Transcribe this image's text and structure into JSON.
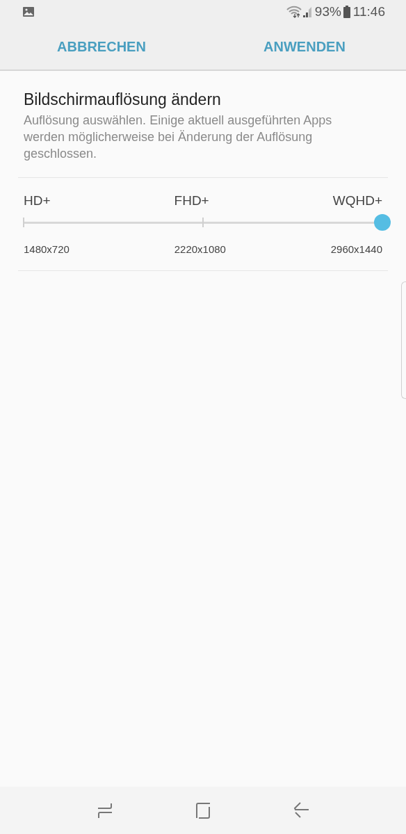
{
  "status_bar": {
    "battery": "93%",
    "time": "11:46"
  },
  "toolbar": {
    "buttons": [
      "ABBRECHEN",
      "ANWENDEN"
    ]
  },
  "title": "Bildschirmauflösung ändern",
  "description": "Auflösung auswählen. Einige aktuell ausgeführten Apps werden möglicherweise bei Änderung der Auflösung geschlossen.",
  "slider": {
    "level": 1,
    "stops": [
      {
        "label": "HD+",
        "resolution": "1480x720"
      },
      {
        "label": "FHD+",
        "resolution": "2220x1080"
      },
      {
        "label": "WQHD+",
        "resolution": "2960x1440"
      }
    ]
  }
}
